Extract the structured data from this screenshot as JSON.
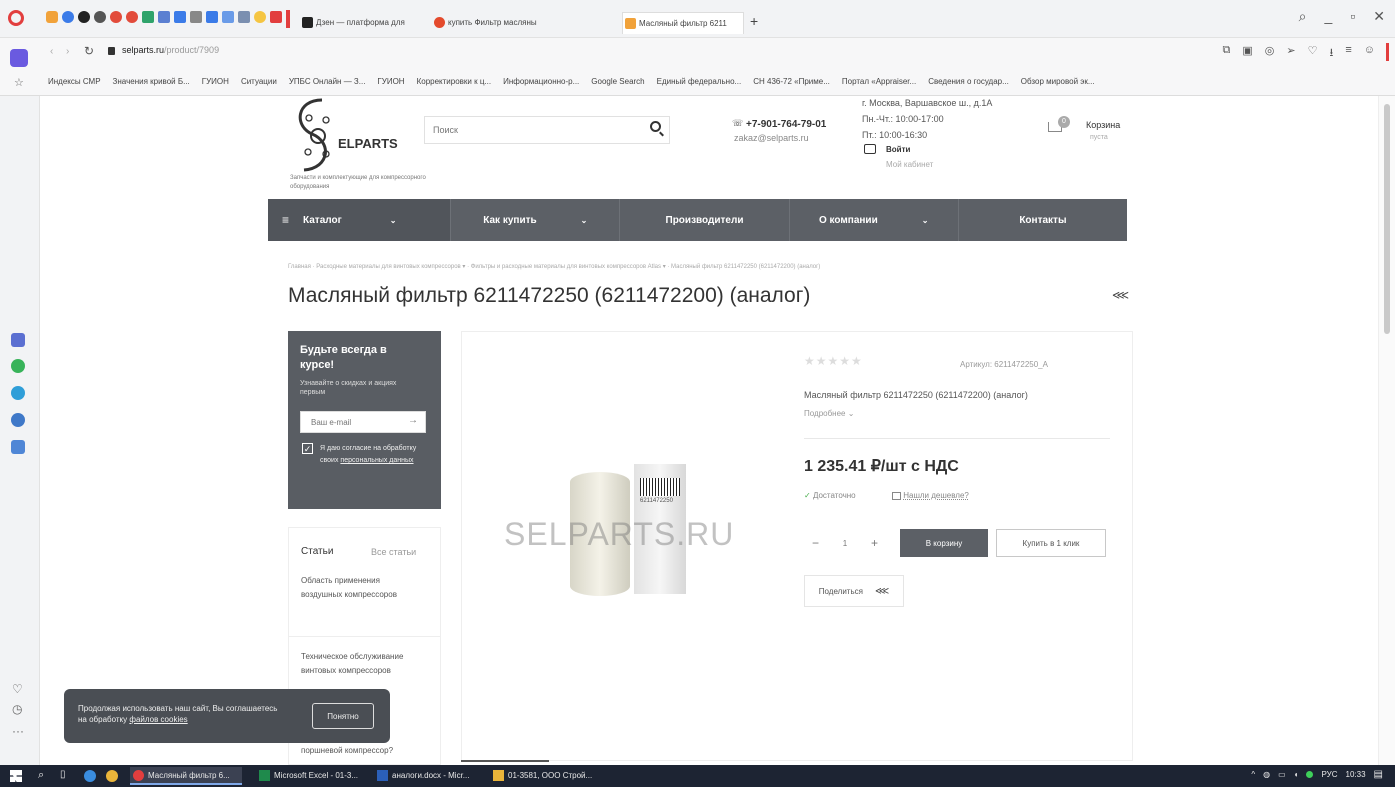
{
  "browser": {
    "tabs": [
      {
        "label": "Дзен — платформа для",
        "color": "#222"
      },
      {
        "label": "купить Фильтр масляны",
        "color": "#e44a2c"
      },
      {
        "label": "Масляный фильтр 6211",
        "color": "#f1a23a"
      }
    ],
    "new_tab": "+",
    "url_host": "selparts.ru",
    "url_path": "/product/7909",
    "bookmarks": [
      "Индексы СМР",
      "Значения кривой Б...",
      "ГУИОН",
      "Ситуации",
      "УПБС Онлайн — З...",
      "ГУИОН",
      "Корректировки к ц...",
      "Информационно-р...",
      "Google Search",
      "Единый федерально...",
      "СН 436-72 «Приме...",
      "Портал «Appraiser...",
      "Сведения о государ...",
      "Обзор мировой эк..."
    ]
  },
  "header": {
    "logo_text": "ELPARTS",
    "tagline": "Запчасти и комплектующие для компрессорного оборудования",
    "search_placeholder": "Поиск",
    "phone": "+7-901-764-79-01",
    "email": "zakaz@selparts.ru",
    "address": "г. Москва, Варшавское ш., д.1А",
    "hours_1": "Пн.-Чт.: 10:00-17:00",
    "hours_2": "Пт.: 10:00-16:30",
    "login": "Войти",
    "cabinet": "Мой кабинет",
    "cart_count": "0",
    "cart_label": "Корзина",
    "cart_status": "пуста"
  },
  "nav": {
    "items": [
      {
        "label": "Каталог",
        "chevron": true
      },
      {
        "label": "Как купить",
        "chevron": true
      },
      {
        "label": "Производители",
        "chevron": false
      },
      {
        "label": "О компании",
        "chevron": true
      },
      {
        "label": "Контакты",
        "chevron": false
      }
    ]
  },
  "breadcrumb": {
    "home": "Главная",
    "crumb_1": "Расходные материалы для винтовых компрессоров",
    "crumb_2": "Фильтры и расходные материалы для винтовых компрессоров Atlas",
    "current": "Масляный фильтр 6211472250 (6211472200) (аналог)"
  },
  "page": {
    "title": "Масляный фильтр 6211472250 (6211472200) (аналог)"
  },
  "subscribe": {
    "title": "Будьте всегда в курсе!",
    "text": "Узнавайте о скидках и акциях первым",
    "email_placeholder": "Ваш e-mail",
    "consent_prefix": "Я даю согласие на обработку своих",
    "consent_link": "персональных данных"
  },
  "articles": {
    "tab_active": "Статьи",
    "tab_all": "Все статьи",
    "items": [
      "Область применения воздушных компрессоров",
      "Техническое обслуживание винтовых компрессоров",
      "поршневой компрессор?"
    ]
  },
  "product": {
    "stars": "★★★★★",
    "article_label": "Артикул:",
    "article": "6211472250_A",
    "name": "Масляный фильтр 6211472250 (6211472200) (аналог)",
    "more": "Подробнее",
    "price": "1 235.41 ₽/шт с НДС",
    "stock": "Достаточно",
    "cheaper": "Нашли дешевле?",
    "minus": "−",
    "qty": "1",
    "plus": "+",
    "add_to_cart": "В корзину",
    "buy_one_click": "Купить в 1 клик",
    "share": "Поделиться",
    "watermark": "SELPARTS.RU",
    "box_code": "6211472250"
  },
  "cookie": {
    "text": "Продолжая использовать наш сайт, Вы соглашаетесь на обработку",
    "link": "файлов cookies",
    "button": "Понятно"
  },
  "taskbar": {
    "apps": [
      "Масляный фильтр 6...",
      "Microsoft Excel - 01-3...",
      "аналоги.docx - Micr...",
      "01-3581, ООО Строй..."
    ],
    "lang": "РУС",
    "time": "10:33"
  },
  "colors": {
    "nav_bg": "#5c6066",
    "sidebar_box": "#595d63",
    "cart_button": "#5c6066",
    "stock_green": "#4caf50",
    "taskbar": "#1d2433"
  }
}
